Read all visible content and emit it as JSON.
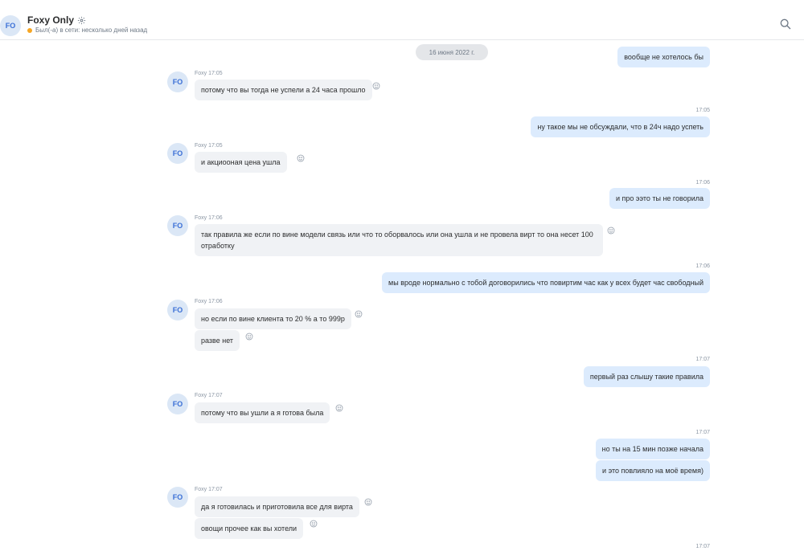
{
  "header": {
    "avatar": "FO",
    "title": "Foxy Only",
    "status": "Был(-а) в сети: несколько дней назад",
    "status_color": "#f6a623"
  },
  "chat": {
    "date_pill": "16 июня 2022 г.",
    "incoming_avatar": "FO",
    "messages": [
      {
        "dir": "out",
        "text": "вообще не хотелось бы"
      },
      {
        "dir": "in",
        "meta": "Foxy 17:05",
        "text": "потому что вы тогда не успели а 24 часа прошло"
      },
      {
        "dir": "out",
        "time": "17:05",
        "text": "ну такое мы не обсуждали, что в 24ч надо успеть"
      },
      {
        "dir": "in",
        "meta": "Foxy 17:05",
        "text": "и акциооная цена ушла"
      },
      {
        "dir": "out",
        "time": "17:06",
        "text": "и про ээто ты не говорила"
      },
      {
        "dir": "in",
        "meta": "Foxy 17:06",
        "text": "так правила же  если по вине модели связь или что то оборвалось или она ушла и не провела вирт то она несет 100 отработку"
      },
      {
        "dir": "out",
        "time": "17:06",
        "text": "мы вроде нормально с тобой договорились что повиртим час как у всех будет час свободный"
      },
      {
        "dir": "in",
        "meta": "Foxy 17:06",
        "text": "но если по вине клиента то 20 % а то 999р"
      },
      {
        "dir": "in",
        "text": "разве нет"
      },
      {
        "dir": "out",
        "time": "17:07",
        "text": "первый раз слышу такие правила"
      },
      {
        "dir": "in",
        "meta": "Foxy 17:07",
        "text": "потому что вы ушли а я готова была"
      },
      {
        "dir": "out",
        "time": "17:07",
        "text": "но ты на 15 мин позже начала"
      },
      {
        "dir": "out",
        "text": "и это повлияло на моё время)"
      },
      {
        "dir": "in",
        "meta": "Foxy 17:07",
        "text": "да я готовилась и приготовила все для вирта"
      },
      {
        "dir": "in",
        "text": "овощи прочее как вы хотели"
      },
      {
        "dir": "out",
        "time": "17:07"
      }
    ]
  }
}
